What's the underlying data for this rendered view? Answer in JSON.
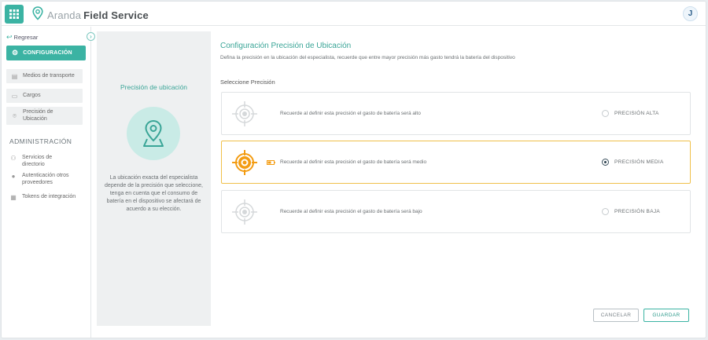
{
  "app": {
    "brand_light": "Aranda",
    "brand_bold": "Field Service",
    "user_initial": "J",
    "accent": "#3bb3a3"
  },
  "sidebar": {
    "back_label": "Regresar",
    "config_label": "CONFIGURACIÓN",
    "items": [
      {
        "label": "Medios de transporte",
        "icon": "car-icon"
      },
      {
        "label": "Cargos",
        "icon": "id-card-icon"
      },
      {
        "label": "Precisión de Ubicación",
        "icon": "location-icon"
      }
    ],
    "admin_heading": "ADMINISTRACIÓN",
    "admin_items": [
      {
        "label": "Servicios de directorio",
        "icon": "directory-icon"
      },
      {
        "label": "Autenticación otros proveedores",
        "icon": "pin-icon"
      },
      {
        "label": "Tokens de integración",
        "icon": "token-icon"
      }
    ]
  },
  "info": {
    "title": "Precisión de ubicación",
    "text": "La ubicación exacta del especialista depende de la precisión que seleccione, tenga en cuenta que el consumo de batería en el dispositivo se afectará de acuerdo a su elección."
  },
  "main": {
    "title": "Configuración Precisión de Ubicación",
    "description": "Defina la precisión en la ubicación del especialista, recuerde que entre mayor precisión más gasto tendrá la batería del dispositivo",
    "select_label": "Seleccione Precisión",
    "options": [
      {
        "text": "Recuerde al definir esta precisión el gasto de batería será alto",
        "label": "PRECISIÓN ALTA",
        "selected": false
      },
      {
        "text": "Recuerde al definir esta precisión el gasto de batería será medio",
        "label": "PRECISIÓN MEDIA",
        "selected": true
      },
      {
        "text": "Recuerde al definir esta precisión el gasto de batería será bajo",
        "label": "PRECISIÓN BAJA",
        "selected": false
      }
    ],
    "cancel_label": "CANCELAR",
    "save_label": "GUARDAR"
  },
  "colors": {
    "selected_border": "#f0c04a",
    "target_active": "#f39c12",
    "target_inactive": "#d5d8da"
  }
}
